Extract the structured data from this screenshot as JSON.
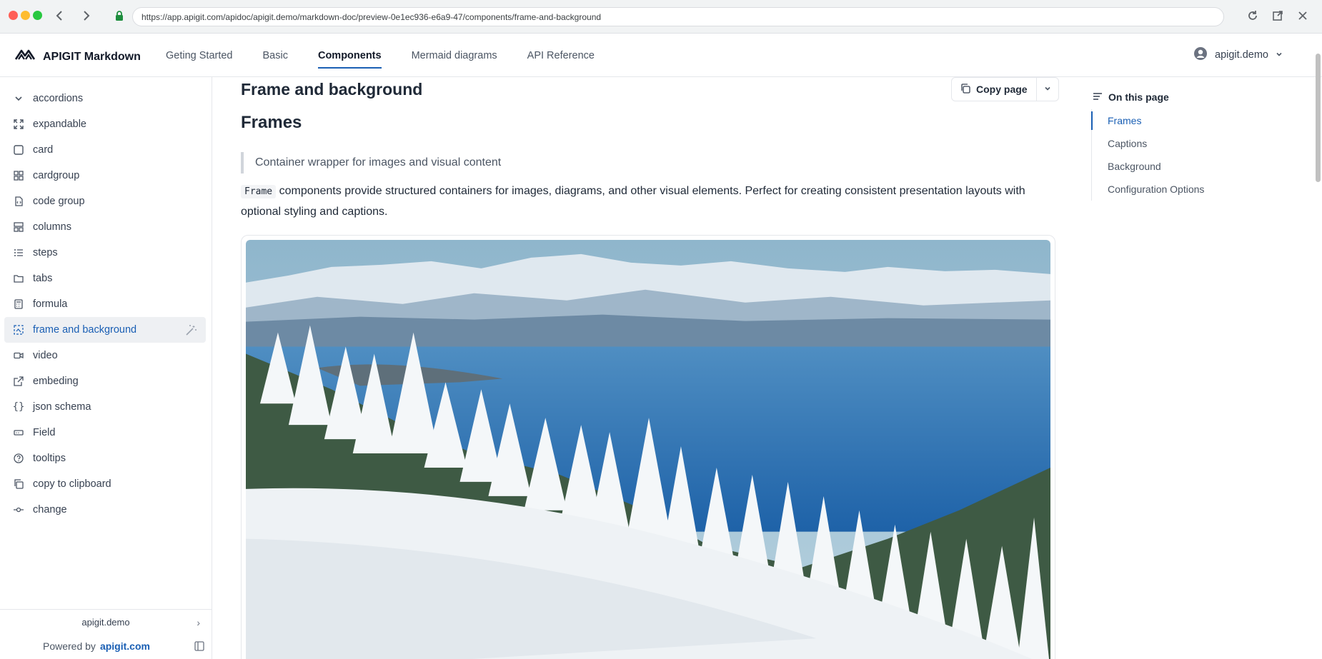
{
  "browser": {
    "url": "https://app.apigit.com/apidoc/apigit.demo/markdown-doc/preview-0e1ec936-e6a9-47/components/frame-and-background"
  },
  "header": {
    "brand": "APIGIT Markdown",
    "nav": [
      {
        "label": "Geting Started",
        "active": false
      },
      {
        "label": "Basic",
        "active": false
      },
      {
        "label": "Components",
        "active": true
      },
      {
        "label": "Mermaid diagrams",
        "active": false
      },
      {
        "label": "API Reference",
        "active": false
      }
    ],
    "user": "apigit.demo"
  },
  "sidebar": {
    "items": [
      {
        "label": "accordions",
        "icon": "chevron-down-icon"
      },
      {
        "label": "expandable",
        "icon": "expand-icon"
      },
      {
        "label": "card",
        "icon": "square-icon"
      },
      {
        "label": "cardgroup",
        "icon": "grid-icon"
      },
      {
        "label": "code group",
        "icon": "file-code-icon"
      },
      {
        "label": "columns",
        "icon": "columns-icon"
      },
      {
        "label": "steps",
        "icon": "list-ordered-icon"
      },
      {
        "label": "tabs",
        "icon": "folder-icon"
      },
      {
        "label": "formula",
        "icon": "calculator-icon"
      },
      {
        "label": "frame and background",
        "icon": "frame-icon",
        "active": true
      },
      {
        "label": "video",
        "icon": "video-icon"
      },
      {
        "label": "embeding",
        "icon": "external-link-icon"
      },
      {
        "label": "json schema",
        "icon": "braces-icon"
      },
      {
        "label": "Field",
        "icon": "field-icon"
      },
      {
        "label": "tooltips",
        "icon": "help-circle-icon"
      },
      {
        "label": "copy to clipboard",
        "icon": "copy-icon"
      },
      {
        "label": "change",
        "icon": "commit-icon"
      }
    ],
    "workspace": "apigit.demo",
    "powered_by": "Powered by",
    "powered_link": "apigit.com"
  },
  "main": {
    "title": "Frame and background",
    "copy_label": "Copy page",
    "section_title": "Frames",
    "quote": "Container wrapper for images and visual content",
    "para_code": "Frame",
    "para_text": " components provide structured containers for images, diagrams, and other visual elements. Perfect for creating consistent presentation layouts with optional styling and captions."
  },
  "toc": {
    "heading": "On this page",
    "items": [
      {
        "label": "Frames",
        "active": true
      },
      {
        "label": "Captions",
        "active": false
      },
      {
        "label": "Background",
        "active": false
      },
      {
        "label": "Configuration Options",
        "active": false
      }
    ]
  },
  "colors": {
    "accent": "#1a5fb4",
    "active_bg": "#eef0f3"
  }
}
